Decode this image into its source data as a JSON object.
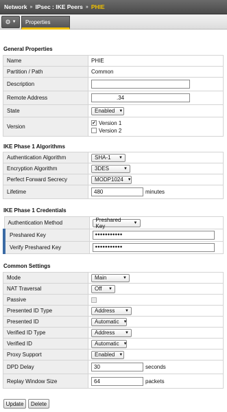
{
  "breadcrumb": {
    "root": "Network",
    "section": "IPsec : IKE Peers",
    "current": "PHIE"
  },
  "toolbar": {
    "tab_label": "Properties"
  },
  "general": {
    "title": "General Properties",
    "name_label": "Name",
    "name_value": "PHIE",
    "partition_label": "Partition / Path",
    "partition_value": "Common",
    "description_label": "Description",
    "description_value": "",
    "remote_label": "Remote Address",
    "remote_value": ".34",
    "state_label": "State",
    "state_value": "Enabled",
    "version_label": "Version",
    "version1": "Version 1",
    "version1_checked": true,
    "version2": "Version 2",
    "version2_checked": false
  },
  "phase1_alg": {
    "title": "IKE Phase 1 Algorithms",
    "auth_label": "Authentication Algorithm",
    "auth_value": "SHA-1",
    "enc_label": "Encryption Algorithm",
    "enc_value": "3DES",
    "pfs_label": "Perfect Forward Secrecy",
    "pfs_value": "MODP1024",
    "lifetime_label": "Lifetime",
    "lifetime_value": "480",
    "lifetime_unit": "minutes"
  },
  "phase1_cred": {
    "title": "IKE Phase 1 Credentials",
    "method_label": "Authentication Method",
    "method_value": "Preshared Key",
    "psk_label": "Preshared Key",
    "psk_value": "●●●●●●●●●●●",
    "verify_label": "Verify Preshared Key",
    "verify_value": "●●●●●●●●●●●"
  },
  "common": {
    "title": "Common Settings",
    "mode_label": "Mode",
    "mode_value": "Main",
    "nat_label": "NAT Traversal",
    "nat_value": "Off",
    "passive_label": "Passive",
    "passive_checked": false,
    "pid_type_label": "Presented ID Type",
    "pid_type_value": "Address",
    "pid_label": "Presented ID",
    "pid_value": "Automatic",
    "vid_type_label": "Verified ID Type",
    "vid_type_value": "Address",
    "vid_label": "Verified ID",
    "vid_value": "Automatic",
    "proxy_label": "Proxy Support",
    "proxy_value": "Enabled",
    "dpd_label": "DPD Delay",
    "dpd_value": "30",
    "dpd_unit": "seconds",
    "replay_label": "Replay Window Size",
    "replay_value": "64",
    "replay_unit": "packets"
  },
  "buttons": {
    "update": "Update",
    "delete": "Delete"
  },
  "colors": {
    "accent": "#f0c000",
    "required_marker": "#3b6ba5",
    "header_bg": "#555555"
  },
  "icons": {
    "gear": "gear-icon",
    "dropdown": "chevron-down-icon",
    "separator": "double-chevron-right-icon",
    "checkmark": "checkmark-icon"
  }
}
